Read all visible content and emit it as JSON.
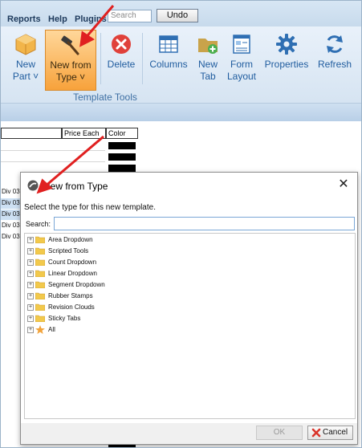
{
  "menubar": {
    "items": [
      "Reports",
      "Help",
      "Plugins"
    ],
    "search_placeholder": "Search",
    "undo_label": "Undo"
  },
  "ribbon": {
    "buttons": {
      "new_part": {
        "line1": "New",
        "line2": "Part ˅"
      },
      "new_from_type": {
        "line1": "New from",
        "line2": "Type ˅"
      },
      "delete": {
        "line1": "Delete"
      },
      "columns": {
        "line1": "Columns"
      },
      "new_tab": {
        "line1": "New",
        "line2": "Tab"
      },
      "form_layout": {
        "line1": "Form",
        "line2": "Layout"
      },
      "properties": {
        "line1": "Properties"
      },
      "refresh": {
        "line1": "Refresh"
      }
    },
    "group_label": "Template Tools"
  },
  "grid": {
    "headers": {
      "price_each": "Price Each",
      "color": "Color"
    },
    "div_cells": [
      "Div 03",
      "Div 03",
      "Div 03",
      "Div 03",
      "Div 03"
    ]
  },
  "dialog": {
    "title": "New from Type",
    "close_glyph": "✕",
    "prompt": "Select the type for this new template.",
    "search_label": "Search:",
    "search_value": "",
    "tree_items": [
      "Area Dropdown",
      "Scripted Tools",
      "Count Dropdown",
      "Linear Dropdown",
      "Segment Dropdown",
      "Rubber Stamps",
      "Revision Clouds",
      "Sticky Tabs",
      "All"
    ],
    "ok_label": "OK",
    "cancel_label": "Cancel"
  },
  "colors": {
    "accent_blue": "#1f5c9e",
    "active_orange": "#f7a23b",
    "delete_red": "#e0413a",
    "annotation_red": "#e02020",
    "folder_yellow": "#f2c94c"
  }
}
